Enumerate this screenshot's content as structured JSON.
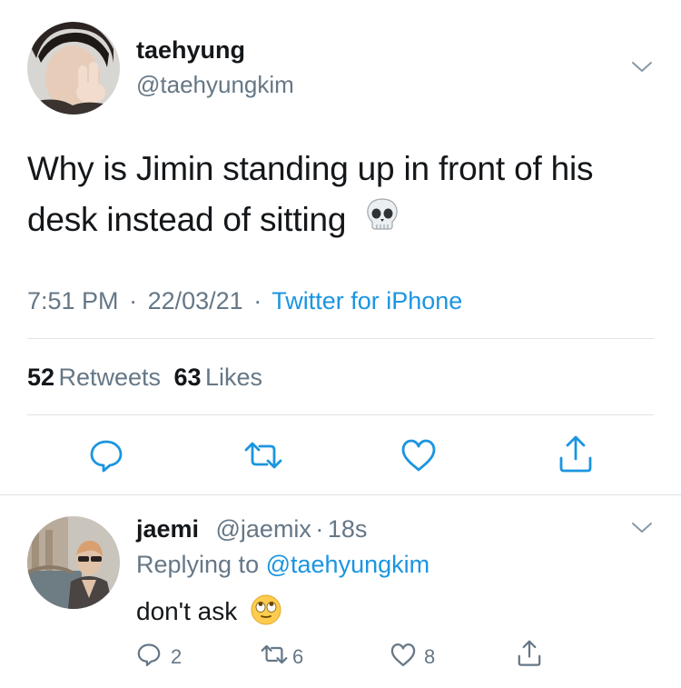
{
  "tweet": {
    "author_name": "taehyung",
    "author_handle": "@taehyungkim",
    "text_line1": "Why is Jimin standing up in front of his",
    "text_line2": "desk instead of sitting",
    "emoji": "skull-emoji",
    "time": "7:51 PM",
    "date": "22/03/21",
    "source": "Twitter for iPhone",
    "separator": "·",
    "retweets_count": "52",
    "retweets_label": "Retweets",
    "likes_count": "63",
    "likes_label": "Likes"
  },
  "actions": [
    "reply-icon",
    "retweet-icon",
    "like-icon",
    "share-icon"
  ],
  "reply": {
    "author_name": "jaemi",
    "author_handle": "@jaemix",
    "separator": "·",
    "time_ago": "18s",
    "replying_prefix": "Replying to",
    "replying_to": "@taehyungkim",
    "text": "don't ask",
    "emoji": "eye-roll-emoji",
    "reply_count": "2",
    "retweet_count": "6",
    "like_count": "8"
  },
  "colors": {
    "text": "#14171a",
    "secondary": "#657786",
    "link": "#1b95e0",
    "divider": "#dfe3e7"
  }
}
